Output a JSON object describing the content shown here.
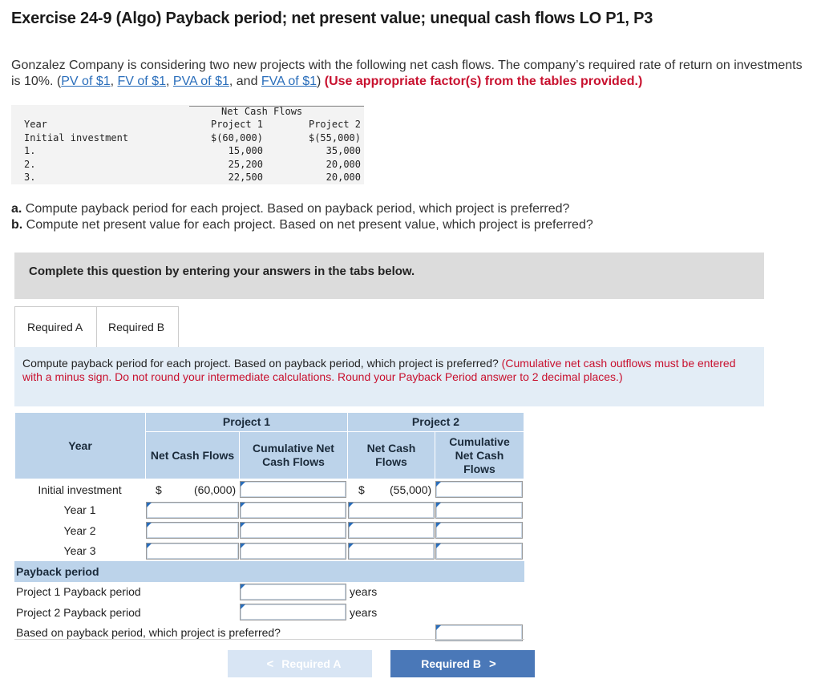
{
  "title": "Exercise 24-9 (Algo) Payback period; net present value; unequal cash flows LO P1, P3",
  "intro": {
    "text1": "Gonzalez Company is considering two new projects with the following net cash flows. The company’s required rate of return on investments is 10%. (",
    "links": [
      "PV of $1",
      "FV of $1",
      "PVA of $1",
      "FVA of $1"
    ],
    "sep1": ", ",
    "sep_and": ", and ",
    "close": ") ",
    "red_note": "(Use appropriate factor(s) from the tables provided.)"
  },
  "cash_flow_table": {
    "header": "Net Cash Flows",
    "columns": [
      "Year",
      "Project 1",
      "Project 2"
    ],
    "rows": [
      [
        "Initial investment",
        "$(60,000)",
        "$(55,000)"
      ],
      [
        "1.",
        "15,000",
        "35,000"
      ],
      [
        "2.",
        "25,200",
        "20,000"
      ],
      [
        "3.",
        "22,500",
        "20,000"
      ]
    ]
  },
  "questions": {
    "a_label": "a.",
    "a_text": " Compute payback period for each project. Based on payback period, which project is preferred?",
    "b_label": "b.",
    "b_text": " Compute net present value for each project. Based on net present value, which project is preferred?"
  },
  "complete_box": "Complete this question by entering your answers in the tabs below.",
  "tabs": [
    "Required A",
    "Required B"
  ],
  "instructions": {
    "main": "Compute payback period for each project. Based on payback period, which project is preferred? ",
    "red": "(Cumulative net cash outflows must be entered with a minus sign. Do not round your intermediate calculations. Round your Payback Period answer to 2 decimal places.)"
  },
  "answer_table": {
    "project1": "Project 1",
    "project2": "Project 2",
    "year": "Year",
    "p1_ncf": "Net Cash Flows",
    "p1_cum": "Cumulative Net Cash Flows",
    "p2_ncf": "Net Cash Flows",
    "p2_cum": "Cumulative Net Cash Flows",
    "rows": [
      "Initial investment",
      "Year 1",
      "Year 2",
      "Year 3"
    ],
    "init_p1_dollar": "$",
    "init_p1_value": "(60,000)",
    "init_p2_dollar": "$",
    "init_p2_value": "(55,000)",
    "payback_period": "Payback period",
    "p1_payback": "Project 1 Payback period",
    "p2_payback": "Project 2 Payback period",
    "years_unit": "years",
    "preferred_q": "Based on payback period, which project is preferred?"
  },
  "nav": {
    "prev_label": "Required A",
    "next_label": "Required B",
    "prev_chev": "<",
    "next_chev": ">"
  },
  "colors": {
    "link": "#2a6ebb",
    "red": "#c8102e",
    "header_blue": "#bcd3ea",
    "instr_bg": "#e3edf6",
    "btn_next": "#4a78b8",
    "btn_prev": "#d8e5f4"
  }
}
